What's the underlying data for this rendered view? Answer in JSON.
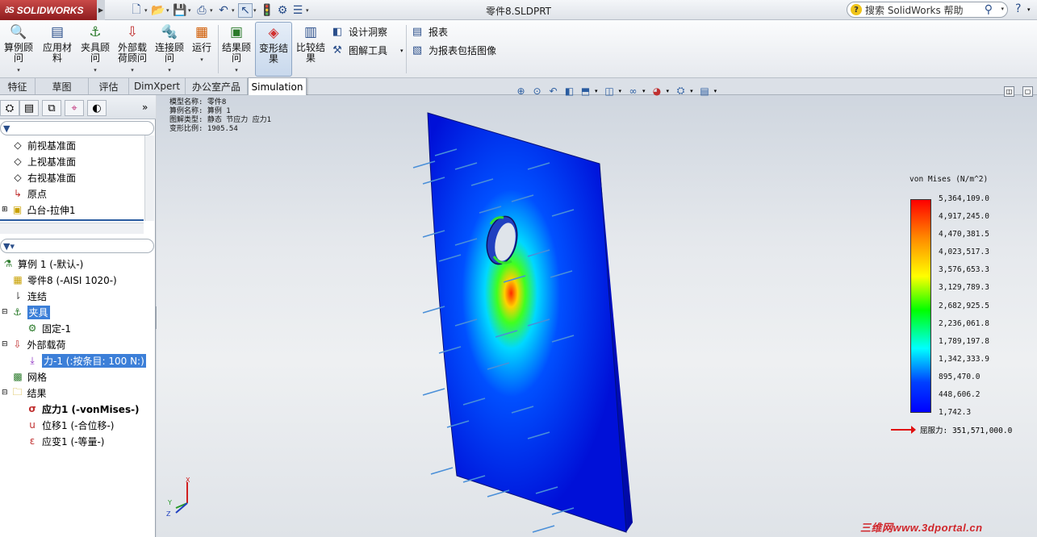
{
  "app": {
    "logo": "SOLIDWORKS",
    "doc_title": "零件8.SLDPRT"
  },
  "quick_access": [
    "new-icon",
    "open-icon",
    "save-icon",
    "print-icon",
    "undo-icon",
    "select-icon",
    "rebuild-icon",
    "options-icon",
    "customize-icon"
  ],
  "help": {
    "search_placeholder": "搜索 SolidWorks 帮助"
  },
  "ribbon": {
    "study_advisor": "算例顾问",
    "apply_material": "应用材料",
    "fixtures_advisor": "夹具顾问",
    "external_loads_advisor": "外部载荷顾问",
    "connections_advisor": "连接顾问",
    "run": "运行",
    "results_advisor": "结果顾问",
    "deformed_result": "变形结果",
    "compare_results": "比较结果",
    "design_insight": "设计洞察",
    "plot_tools": "图解工具",
    "report": "报表",
    "include_image": "为报表包括图像"
  },
  "tabs": [
    "特征",
    "草图",
    "评估",
    "DimXpert",
    "办公室产品",
    "Simulation"
  ],
  "feature_tree": [
    {
      "label": "前视基准面",
      "icon": "plane-icon"
    },
    {
      "label": "上视基准面",
      "icon": "plane-icon"
    },
    {
      "label": "右视基准面",
      "icon": "plane-icon"
    },
    {
      "label": "原点",
      "icon": "origin-icon"
    },
    {
      "label": "凸台-拉伸1",
      "icon": "extrude-icon"
    }
  ],
  "sim_tree": {
    "study": "算例 1 (-默认-)",
    "part": "零件8 (-AISI 1020-)",
    "connections": "连结",
    "fixtures": "夹具",
    "fixed": "固定-1",
    "external_loads": "外部载荷",
    "force": "力-1 (:按条目: 100 N:)",
    "mesh": "网格",
    "results": "结果",
    "stress": "应力1 (-vonMises-)",
    "displacement": "位移1 (-合位移-)",
    "strain": "应变1 (-等量-)"
  },
  "hud": [
    "模型名称: 零件8",
    "算例名称: 算例 1",
    "图解类型: 静态 节应力 应力1",
    "变形比例: 1905.54"
  ],
  "legend": {
    "title": "von Mises (N/m^2)",
    "values": [
      "5,364,109.0",
      "4,917,245.0",
      "4,470,381.5",
      "4,023,517.3",
      "3,576,653.3",
      "3,129,789.3",
      "2,682,925.5",
      "2,236,061.8",
      "1,789,197.8",
      "1,342,333.9",
      "895,470.0",
      "448,606.2",
      "1,742.3"
    ],
    "yield": "屈服力: 351,571,000.0"
  },
  "watermark": "三维网www.3dportal.cn",
  "colors": {
    "stress_max": "#ff0000",
    "stress_min": "#0000ff",
    "accent": "#3c7fd8"
  }
}
